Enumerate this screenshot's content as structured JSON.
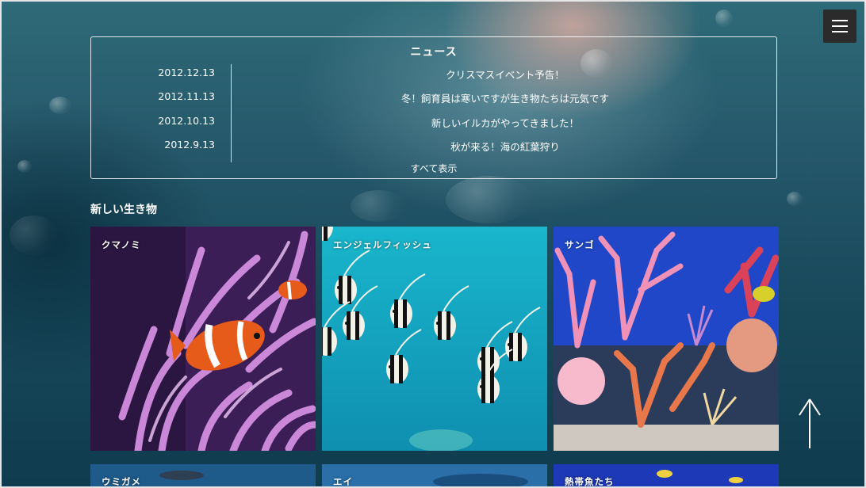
{
  "menu": {
    "icon": "hamburger-menu-icon"
  },
  "news": {
    "title": "ニュース",
    "items": [
      {
        "date": "2012.12.13",
        "text": "クリスマスイベント予告！"
      },
      {
        "date": "2012.11.13",
        "text": "冬！飼育員は寒いですが生き物たちは元気です"
      },
      {
        "date": "2012.10.13",
        "text": "新しいイルカがやってきました！"
      },
      {
        "date": "2012.9.13",
        "text": "秋が来る！海の紅葉狩り"
      }
    ],
    "view_all": "すべて表示"
  },
  "creatures": {
    "heading": "新しい生き物",
    "cards": [
      {
        "label": "クマノミ"
      },
      {
        "label": "エンジェルフィッシュ"
      },
      {
        "label": "サンゴ"
      },
      {
        "label": "ウミガメ"
      },
      {
        "label": "エイ"
      },
      {
        "label": "熱帯魚たち"
      }
    ]
  },
  "scroll_top": {
    "icon": "arrow-up-icon"
  },
  "colors": {
    "background": "#1d5466",
    "menu_button": "#2b2b2b",
    "coral_pink": "#c77ad0",
    "clownfish_orange": "#e65a1a",
    "lagoon_blue": "#17a9c4"
  }
}
